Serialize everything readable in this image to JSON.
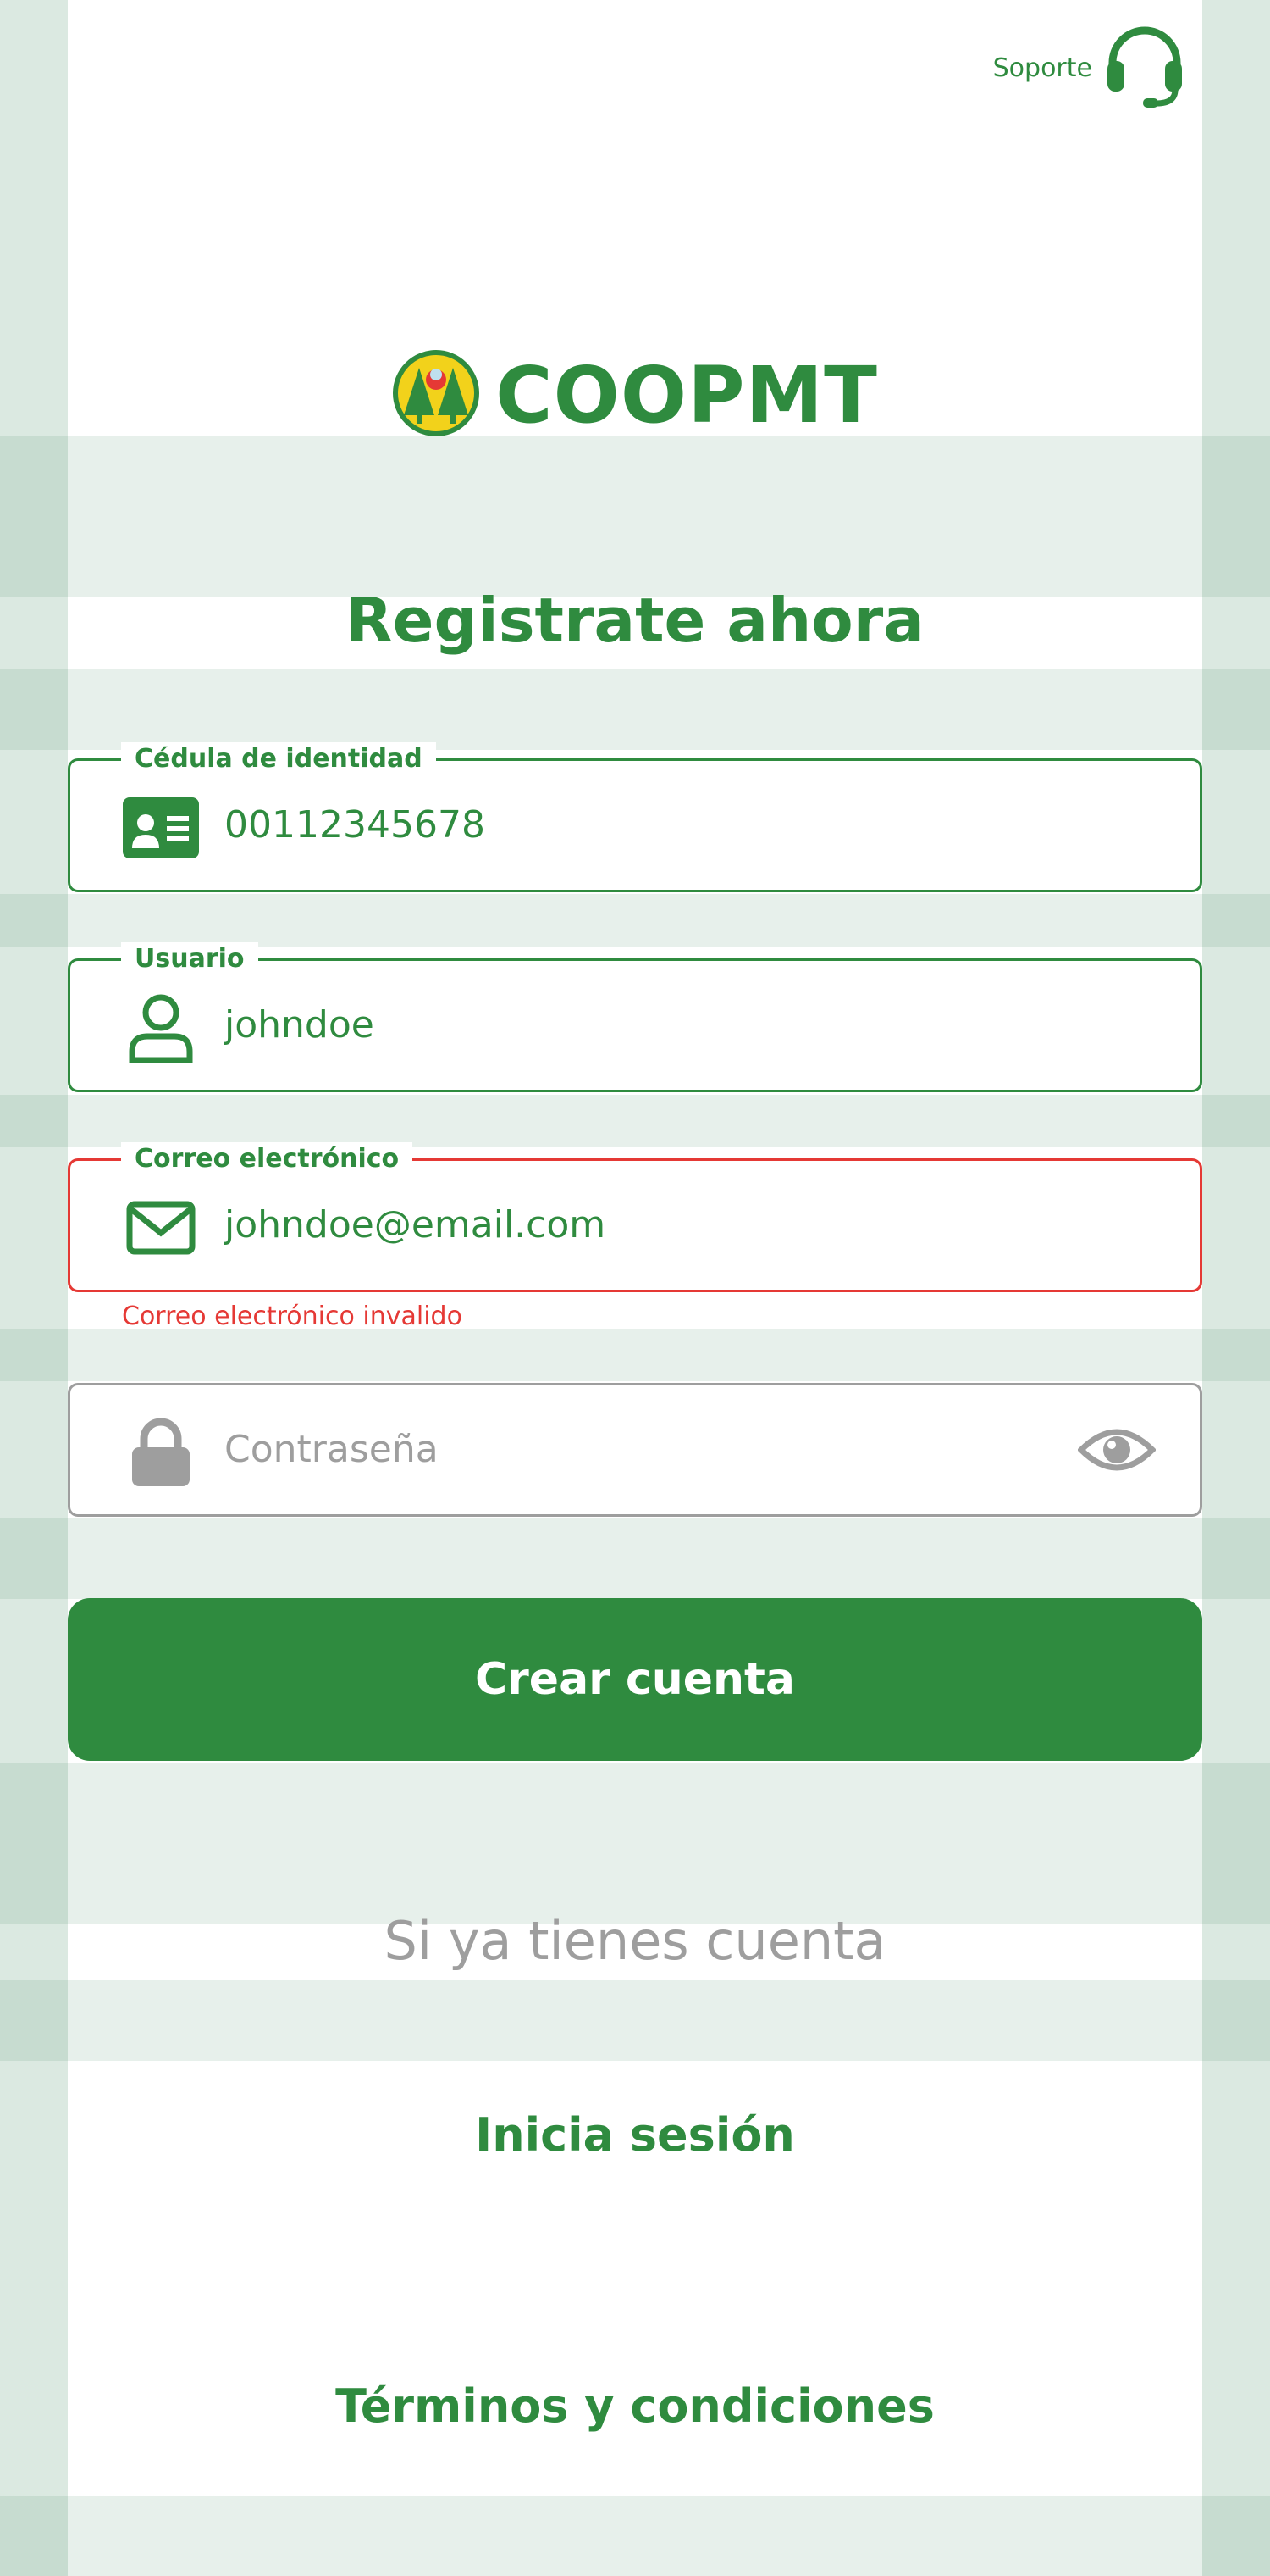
{
  "header": {
    "support_label": "Soporte"
  },
  "brand": {
    "name": "COOPMT"
  },
  "title": "Registrate ahora",
  "form": {
    "cedula": {
      "label": "Cédula de identidad",
      "value": "00112345678"
    },
    "usuario": {
      "label": "Usuario",
      "value": "johndoe"
    },
    "correo": {
      "label": "Correo electrónico",
      "value": "johndoe@email.com",
      "error": "Correo electrónico invalido"
    },
    "password": {
      "placeholder": "Contraseña",
      "value": ""
    }
  },
  "actions": {
    "create_account": "Crear cuenta",
    "have_account_text": "Si ya tienes cuenta",
    "login_link": "Inicia sesión",
    "terms_link": "Términos y condiciones"
  },
  "colors": {
    "primary": "#2f8b3f",
    "error": "#e53935",
    "muted": "#9e9e9e",
    "side": "#dbe9e1"
  },
  "icons": [
    "headset-icon",
    "coop-logo-icon",
    "id-card-icon",
    "user-icon",
    "mail-icon",
    "lock-icon",
    "eye-icon"
  ]
}
